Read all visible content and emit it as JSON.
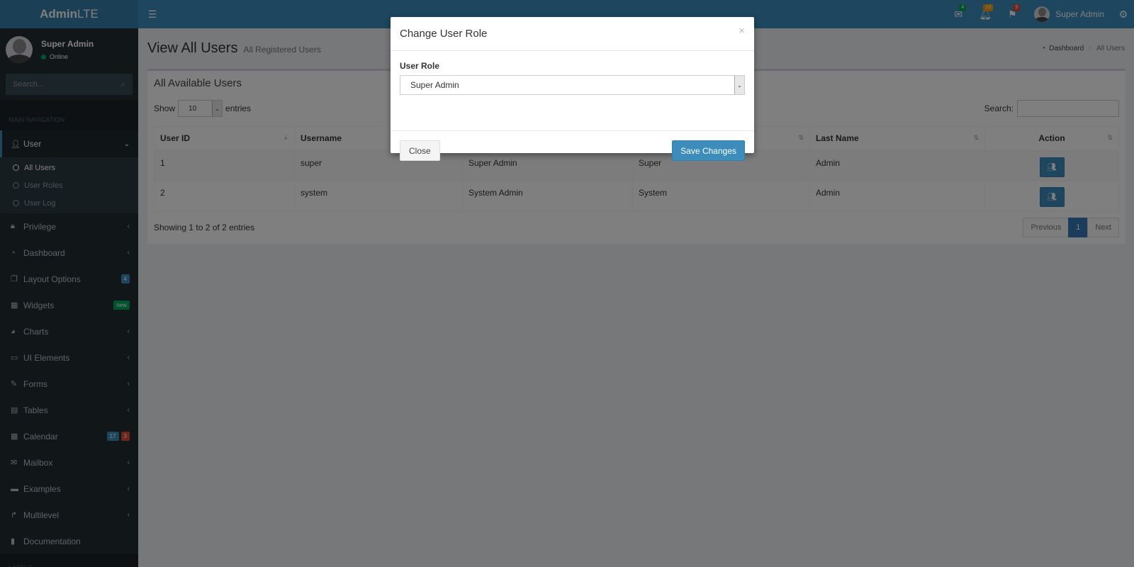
{
  "header": {
    "logo_bold": "Admin",
    "logo_light": "LTE",
    "mail_count": "4",
    "notif_count": "10",
    "flag_count": "9",
    "user_name": "Super Admin",
    "colors": {
      "primary": "#3c8dbc",
      "logo_bg": "#367fa9"
    }
  },
  "sidebar": {
    "user_name": "Super Admin",
    "status": "Online",
    "search_placeholder": "Search...",
    "nav_header": "MAIN NAVIGATION",
    "labels_header": "LABELS",
    "active_menu": {
      "icon": "user-icon",
      "label": "User"
    },
    "submenu": [
      {
        "label": "All Users",
        "active": true
      },
      {
        "label": "User Roles",
        "active": false
      },
      {
        "label": "User Log",
        "active": false
      }
    ],
    "items": [
      {
        "icon": "lock-icon",
        "label": "Privilege"
      },
      {
        "icon": "dashboard-icon",
        "label": "Dashboard"
      },
      {
        "icon": "files-icon",
        "label": "Layout Options",
        "badge": "4"
      },
      {
        "icon": "grid-icon",
        "label": "Widgets",
        "badge": "new"
      },
      {
        "icon": "pie-chart-icon",
        "label": "Charts"
      },
      {
        "icon": "laptop-icon",
        "label": "UI Elements"
      },
      {
        "icon": "edit-icon",
        "label": "Forms"
      },
      {
        "icon": "table-icon",
        "label": "Tables"
      },
      {
        "icon": "calendar-icon",
        "label": "Calendar",
        "badge1": "17",
        "badge2": "3"
      },
      {
        "icon": "envelope-icon",
        "label": "Mailbox"
      },
      {
        "icon": "folder-icon",
        "label": "Examples"
      },
      {
        "icon": "share-icon",
        "label": "Multilevel"
      },
      {
        "icon": "book-icon",
        "label": "Documentation"
      }
    ]
  },
  "page": {
    "title": "View All Users",
    "subtitle": "All Registered Users",
    "breadcrumb_home": "Dashboard",
    "breadcrumb_current": "All Users"
  },
  "table_box": {
    "title": "All Available Users",
    "show_label": "Show",
    "entries_label": "entries",
    "length_value": "10",
    "search_label": "Search:",
    "columns": [
      "User ID",
      "Username",
      "",
      "",
      "Last Name",
      "Action"
    ],
    "rows": [
      {
        "id": "1",
        "username": "super",
        "role": "Super Admin",
        "first_name": "Super",
        "last_name": "Admin"
      },
      {
        "id": "2",
        "username": "system",
        "role": "System Admin",
        "first_name": "System",
        "last_name": "Admin"
      }
    ],
    "info": "Showing 1 to 2 of 2 entries",
    "pager": {
      "previous": "Previous",
      "current": "1",
      "next": "Next"
    }
  },
  "modal": {
    "title": "Change User Role",
    "close_symbol": "×",
    "field_label": "User Role",
    "selected_role": "Super Admin",
    "close_button": "Close",
    "save_button": "Save Changes"
  }
}
